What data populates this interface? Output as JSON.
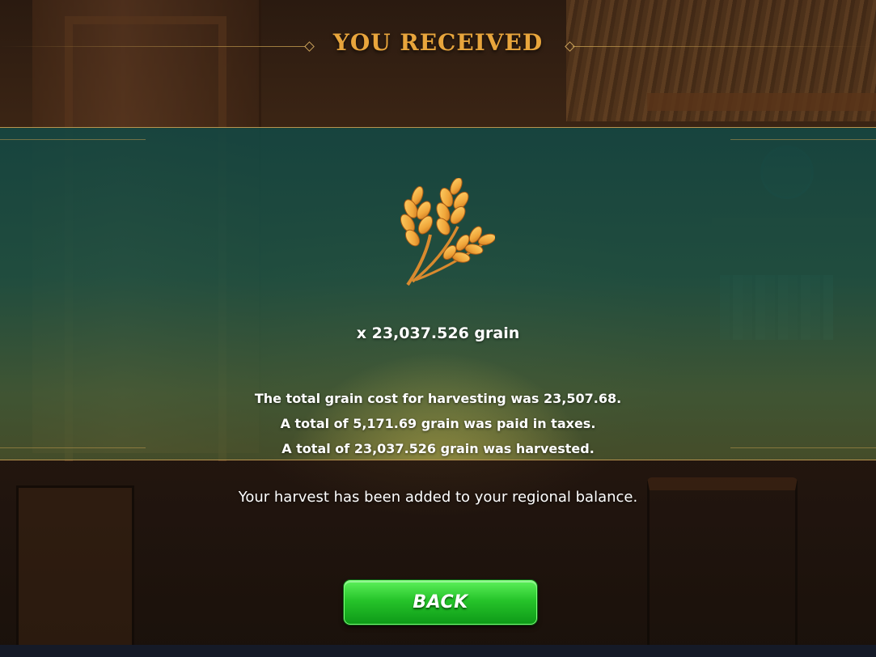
{
  "header": {
    "title": "YOU RECEIVED"
  },
  "reward": {
    "icon": "wheat-grain-icon",
    "amount_text": "x 23,037.526 grain",
    "details": [
      "The total grain cost for harvesting was 23,507.68.",
      "A total of 5,171.69 grain was paid in taxes.",
      "A total of 23,037.526 grain was harvested."
    ]
  },
  "message": "Your harvest has been added to your regional balance.",
  "actions": {
    "back_label": "BACK"
  },
  "colors": {
    "title": "#e8a53c",
    "button": "#26c42a",
    "panel_border": "#b8944f"
  }
}
